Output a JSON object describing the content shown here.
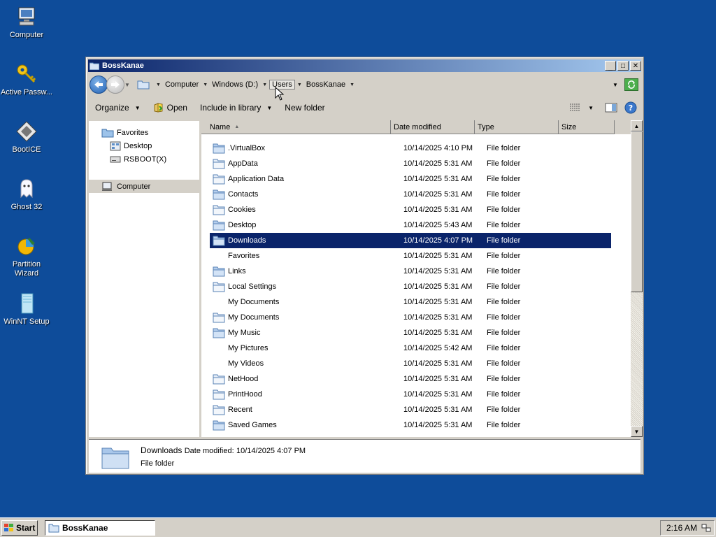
{
  "desktop": {
    "icons": [
      {
        "label": "Computer",
        "icon": "computer-icon"
      },
      {
        "label": "Active Passw...",
        "icon": "key-icon"
      },
      {
        "label": "BootICE",
        "icon": "booticе-icon"
      },
      {
        "label": "Ghost 32",
        "icon": "ghost-icon"
      },
      {
        "label": "Partition Wizard",
        "icon": "partition-wizard-icon"
      },
      {
        "label": "WinNT Setup",
        "icon": "winnt-setup-icon"
      }
    ]
  },
  "window": {
    "title": "BossKanae",
    "controls": {
      "minimize": "_",
      "maximize": "□",
      "close": "✕"
    },
    "address": {
      "crumbs": [
        "Computer",
        "Windows (D:)",
        "Users",
        "BossKanae"
      ]
    },
    "commands": {
      "organize": "Organize",
      "open": "Open",
      "include_in_library": "Include in library",
      "new_folder": "New folder"
    },
    "nav": {
      "favorites": "Favorites",
      "desktop": "Desktop",
      "rsboot": "RSBOOT(X)",
      "computer": "Computer"
    },
    "columns": {
      "name": "Name",
      "date": "Date modified",
      "type": "Type",
      "size": "Size"
    },
    "files": [
      {
        "name": ".VirtualBox",
        "date": "10/14/2025 4:10 PM",
        "type": "File folder",
        "icon": "folder"
      },
      {
        "name": "AppData",
        "date": "10/14/2025 5:31 AM",
        "type": "File folder",
        "icon": "folder-light"
      },
      {
        "name": "Application Data",
        "date": "10/14/2025 5:31 AM",
        "type": "File folder",
        "icon": "folder-light"
      },
      {
        "name": "Contacts",
        "date": "10/14/2025 5:31 AM",
        "type": "File folder",
        "icon": "folder"
      },
      {
        "name": "Cookies",
        "date": "10/14/2025 5:31 AM",
        "type": "File folder",
        "icon": "folder-light"
      },
      {
        "name": "Desktop",
        "date": "10/14/2025 5:43 AM",
        "type": "File folder",
        "icon": "folder"
      },
      {
        "name": "Downloads",
        "date": "10/14/2025 4:07 PM",
        "type": "File folder",
        "icon": "folder",
        "selected": true
      },
      {
        "name": "Favorites",
        "date": "10/14/2025 5:31 AM",
        "type": "File folder",
        "icon": "none"
      },
      {
        "name": "Links",
        "date": "10/14/2025 5:31 AM",
        "type": "File folder",
        "icon": "folder"
      },
      {
        "name": "Local Settings",
        "date": "10/14/2025 5:31 AM",
        "type": "File folder",
        "icon": "folder-light"
      },
      {
        "name": "My Documents",
        "date": "10/14/2025 5:31 AM",
        "type": "File folder",
        "icon": "none"
      },
      {
        "name": "My Documents",
        "date": "10/14/2025 5:31 AM",
        "type": "File folder",
        "icon": "folder-light"
      },
      {
        "name": "My Music",
        "date": "10/14/2025 5:31 AM",
        "type": "File folder",
        "icon": "folder"
      },
      {
        "name": "My Pictures",
        "date": "10/14/2025 5:42 AM",
        "type": "File folder",
        "icon": "none"
      },
      {
        "name": "My Videos",
        "date": "10/14/2025 5:31 AM",
        "type": "File folder",
        "icon": "none"
      },
      {
        "name": "NetHood",
        "date": "10/14/2025 5:31 AM",
        "type": "File folder",
        "icon": "folder-light"
      },
      {
        "name": "PrintHood",
        "date": "10/14/2025 5:31 AM",
        "type": "File folder",
        "icon": "folder-light"
      },
      {
        "name": "Recent",
        "date": "10/14/2025 5:31 AM",
        "type": "File folder",
        "icon": "folder-light"
      },
      {
        "name": "Saved Games",
        "date": "10/14/2025 5:31 AM",
        "type": "File folder",
        "icon": "folder"
      }
    ],
    "details": {
      "name": "Downloads",
      "date_label": "Date modified:",
      "date_value": "10/14/2025 4:07 PM",
      "type": "File folder"
    }
  },
  "taskbar": {
    "start": "Start",
    "task": "BossKanae",
    "clock": "2:16 AM"
  },
  "colors": {
    "desktop": "#0e4c9a",
    "titlebar_start": "#0a246a",
    "titlebar_end": "#a6caf0",
    "selection": "#0a246a",
    "chrome": "#d4d0c8"
  }
}
